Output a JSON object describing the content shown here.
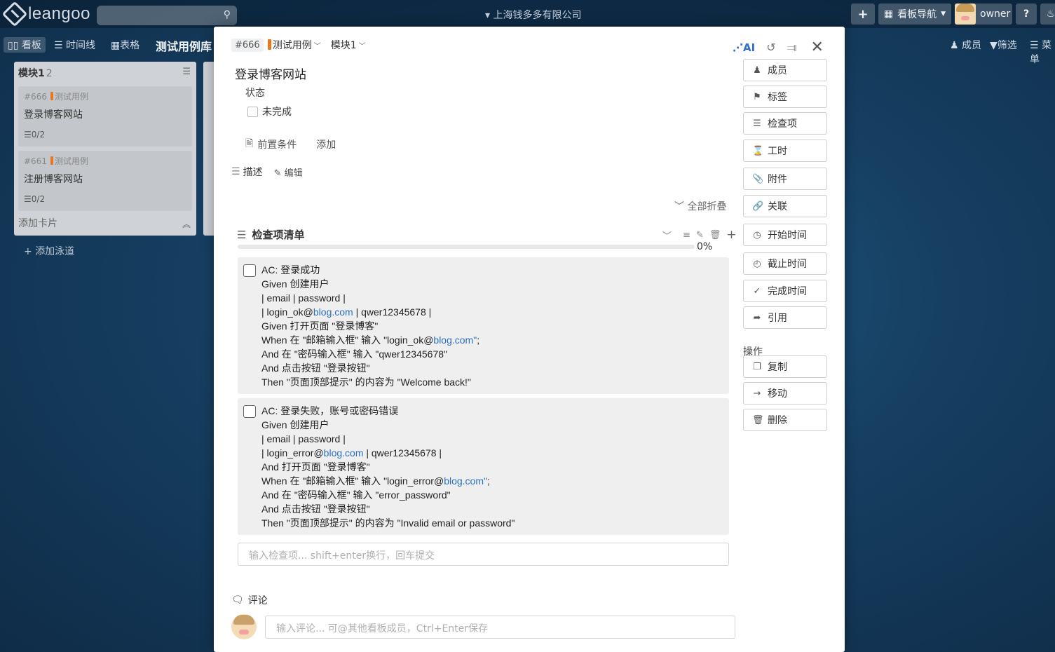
{
  "app": {
    "logo_text": "leangoo",
    "company": "上海钱多多有限公司",
    "user": "owner",
    "board_nav": "看板导航",
    "help": "?",
    "plus": "+"
  },
  "views": {
    "board": "看板",
    "timeline": "时间线",
    "table": "表格",
    "board_title": "测试用例库",
    "members": "成员",
    "filter": "筛选",
    "menu": "菜单"
  },
  "lane": {
    "title": "模块1",
    "count": "2",
    "add_card": "添加卡片",
    "add_lane": "添加泳道",
    "cards": [
      {
        "id": "#666",
        "tag": "测试用例",
        "title": "登录博客网站",
        "checklist": "0/2"
      },
      {
        "id": "#661",
        "tag": "测试用例",
        "title": "注册博客网站",
        "checklist": "0/2"
      }
    ]
  },
  "modal": {
    "card_id": "#666",
    "card_type": "测试用例",
    "module": "模块1",
    "title": "登录博客网站",
    "status_label": "状态",
    "status_value": "未完成",
    "precondition": "前置条件",
    "precondition_add": "添加",
    "description": "描述",
    "edit": "编辑",
    "collapse_all": "全部折叠",
    "checklist_title": "检查项清单",
    "progress_text": "0%",
    "progress_value": 0,
    "checklist_items": [
      {
        "lines": [
          "AC: 登录成功",
          "Given 创建用户",
          "| email | password |",
          "| login_ok@",
          "blog.com",
          " | qwer12345678 |",
          "Given 打开页面 \"登录博客\"",
          "When 在 \"邮箱输入框\" 输入 \"login_ok@",
          "blog.com\"",
          ";",
          "And 在 \"密码输入框\" 输入 \"qwer12345678\"",
          "And 点击按钮 \"登录按钮\"",
          "Then \"页面顶部提示\" 的内容为 \"Welcome back!\""
        ]
      },
      {
        "lines": [
          "AC: 登录失败，账号或密码错误",
          "Given 创建用户",
          "| email | password |",
          "| login_error@",
          "blog.com",
          " | qwer12345678 |",
          "And 打开页面 \"登录博客\"",
          "When 在 \"邮箱输入框\" 输入 \"login_error@",
          "blog.com\"",
          ";",
          "And 在 \"密码输入框\" 输入 \"error_password\"",
          "And 点击按钮 \"登录按钮\"",
          "Then \"页面顶部提示\" 的内容为 \"Invalid email or password\""
        ]
      }
    ],
    "checklist_placeholder": "输入检查项... shift+enter换行，回车提交",
    "comment_label": "评论",
    "comment_placeholder": "输入评论... 可@其他看板成员，Ctrl+Enter保存",
    "ai_label": "AI"
  },
  "sidebar": {
    "buttons": [
      "成员",
      "标签",
      "检查项",
      "工时",
      "附件",
      "关联",
      "开始时间",
      "截止时间",
      "完成时间",
      "引用"
    ],
    "actions_label": "操作",
    "actions": [
      "复制",
      "移动",
      "删除"
    ]
  },
  "colors": {
    "accent": "#2f6fd1",
    "tag": "#e6781e",
    "link": "#2a6fc0"
  }
}
